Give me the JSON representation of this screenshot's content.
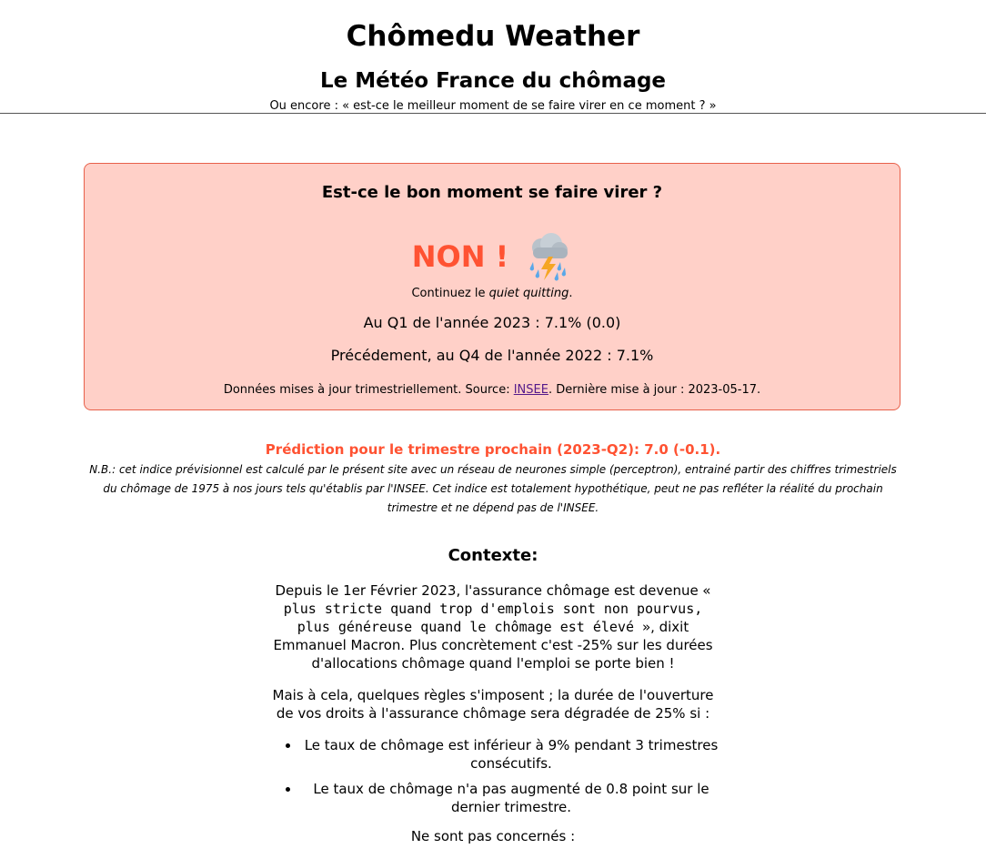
{
  "header": {
    "title": "Chômedu Weather",
    "subtitle": "Le Météo France du chômage",
    "tagline": "Ou encore : « est-ce le meilleur moment de se faire virer en ce moment ? »"
  },
  "verdict": {
    "question": "Est-ce le bon moment se faire virer ?",
    "answer": "NON !",
    "icon": "thunderstorm-rain-icon",
    "advice_prefix": "Continuez le ",
    "advice_italic": "quiet quitting",
    "advice_suffix": ".",
    "current_rate": "Au Q1 de l'année 2023 : 7.1% (0.0)",
    "previous_rate": "Précédement, au Q4 de l'année 2022 : 7.1%",
    "source_prefix": "Données mises à jour trimestriellement. Source: ",
    "source_link": "INSEE",
    "source_suffix": ". Dernière mise à jour : 2023-05-17.",
    "colors": {
      "background": "#ffd0c8",
      "accent": "#ff5232"
    }
  },
  "prediction": {
    "title": "Prédiction pour le trimestre prochain (2023-Q2): 7.0 (-0.1).",
    "note": "N.B.: cet indice prévisionnel est calculé par le présent site avec un réseau de neurones simple (perceptron), entrainé partir des chiffres trimestriels du chômage de 1975 à nos jours tels qu'établis par l'INSEE. Cet indice est totalement hypothétique, peut ne pas refléter la réalité du prochain trimestre et ne dépend pas de l'INSEE."
  },
  "context": {
    "heading": "Contexte:",
    "p1_prefix": "Depuis le 1er Février 2023, l'assurance chômage est devenue ",
    "p1_quote": "« plus stricte quand trop d'emplois sont non pourvus, plus généreuse quand le chômage est élevé »",
    "p1_suffix": ", dixit Emmanuel Macron. Plus concrètement c'est -25% sur les durées d'allocations chômage quand l'emploi se porte bien !",
    "p2": "Mais à cela, quelques règles s'imposent ; la durée de l'ouverture de vos droits à l'assurance chômage sera dégradée de 25% si :",
    "rules": [
      "Le taux de chômage est inférieur à 9% pendant 3 trimestres consécutifs.",
      "Le taux de chômage n'a pas augmenté de 0.8 point sur le dernier trimestre."
    ],
    "p3": "Ne sont pas concernés :"
  }
}
